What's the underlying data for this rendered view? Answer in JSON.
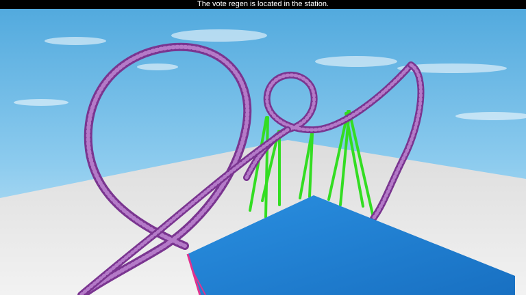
{
  "message_bar": {
    "text": "The vote regen is located in the station."
  },
  "colors": {
    "sky_top": "#5aaee0",
    "sky_bottom": "#c7e7f6",
    "baseplate": "#e3e3e3",
    "track_rail": "#8a3f9e",
    "track_tie": "#5e2a6e",
    "supports": "#33dd22",
    "platform_top": "#1f84d8",
    "platform_leg": "#e0338f",
    "message_bg": "#000000",
    "message_text": "#ffffff"
  }
}
